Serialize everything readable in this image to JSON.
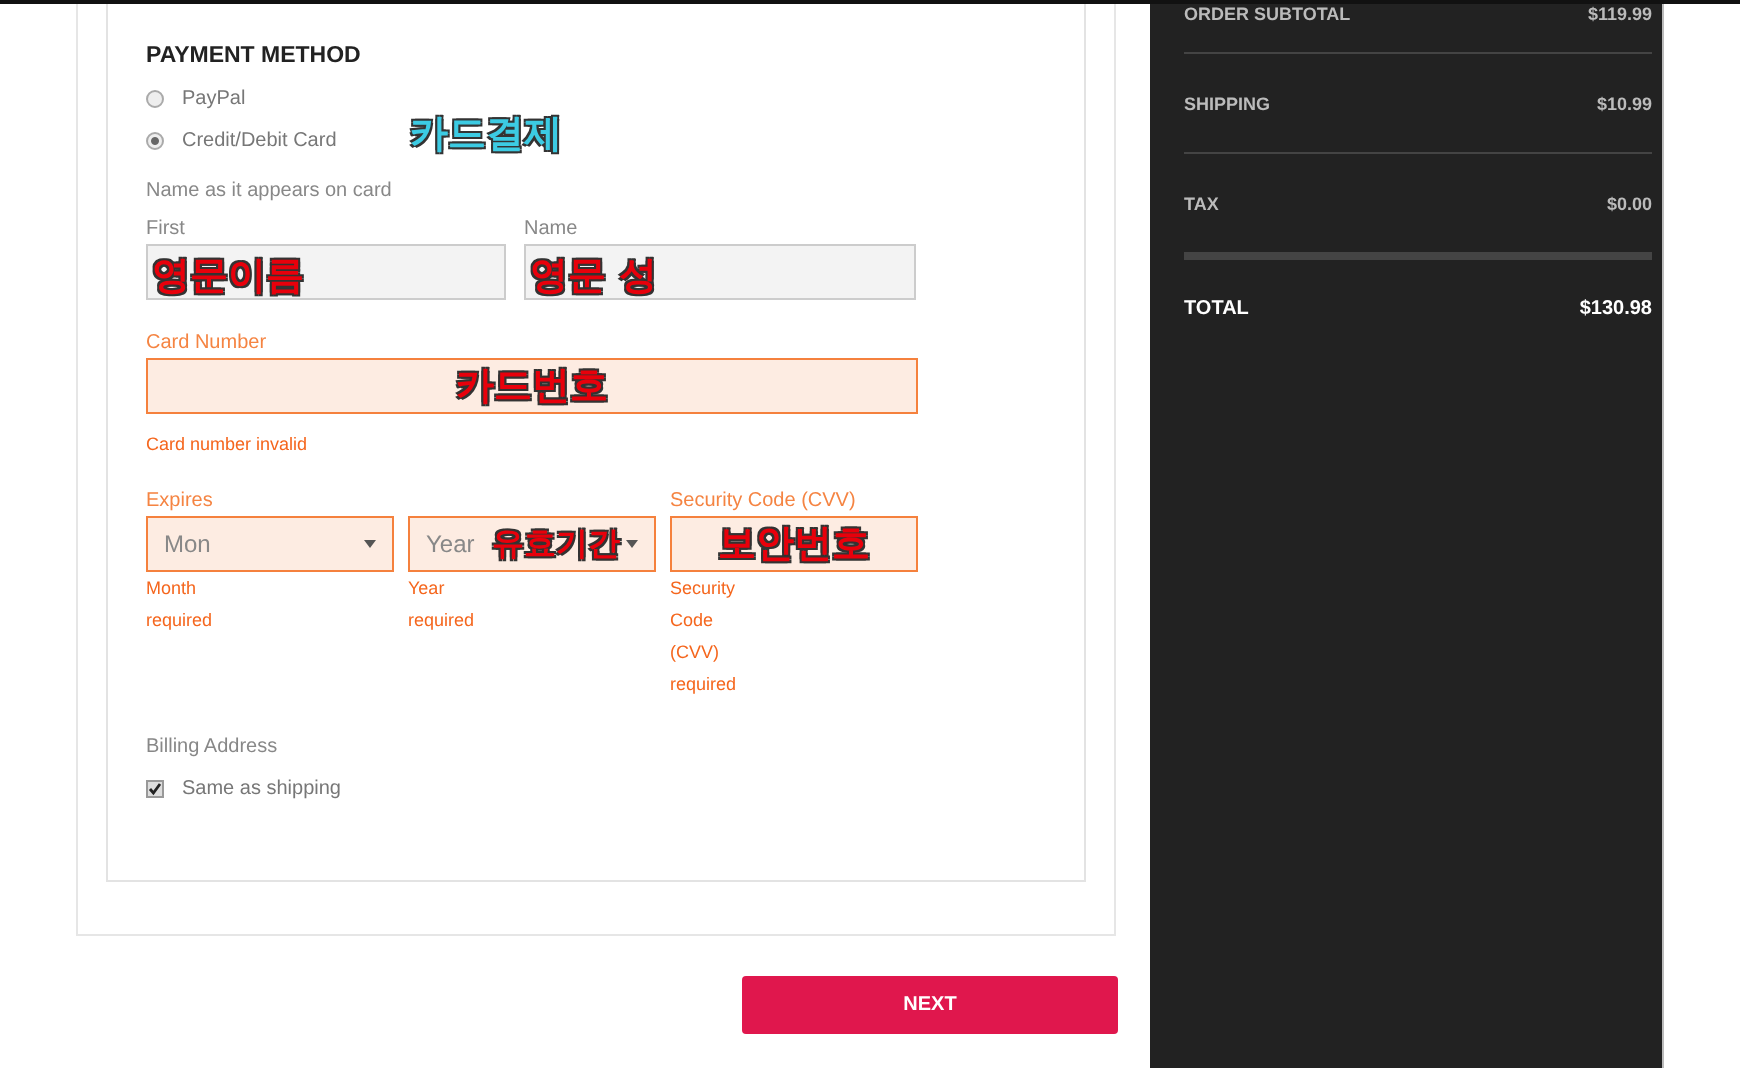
{
  "payment": {
    "title": "PAYMENT METHOD",
    "annotation": "카드결제",
    "options": [
      {
        "label": "PayPal",
        "selected": false
      },
      {
        "label": "Credit/Debit Card",
        "selected": true
      }
    ],
    "name_label": "Name as it appears on card",
    "name_fields": [
      {
        "label": "First",
        "annotation": "영문이름"
      },
      {
        "label": "Name",
        "annotation": "영문 성"
      }
    ],
    "card_number": {
      "label": "Card Number",
      "invalid": true,
      "error": "Card number invalid",
      "annotation": "카드번호"
    },
    "expires": {
      "label": "Expires",
      "invalid": true,
      "selects": [
        {
          "placeholder": "Mon",
          "errors": [
            "Month",
            "required"
          ]
        },
        {
          "placeholder": "Year",
          "annotation": "유효기간",
          "errors": [
            "Year",
            "required"
          ]
        }
      ]
    },
    "cvv": {
      "label": "Security Code (CVV)",
      "invalid": true,
      "annotation": "보안번호",
      "errors": [
        "Security",
        "Code",
        "(CVV)",
        "required"
      ]
    },
    "billing": {
      "label": "Billing Address",
      "same_as_shipping": {
        "label": "Same as shipping",
        "checked": true
      }
    }
  },
  "next_button": "NEXT",
  "summary": [
    {
      "kind": "line",
      "label": "ORDER SUBTOTAL",
      "value": "$119.99"
    },
    {
      "kind": "line",
      "label": "SHIPPING",
      "value": "$10.99"
    },
    {
      "kind": "line",
      "label": "TAX",
      "value": "$0.00"
    },
    {
      "kind": "total",
      "label": "TOTAL",
      "value": "$130.98"
    }
  ]
}
